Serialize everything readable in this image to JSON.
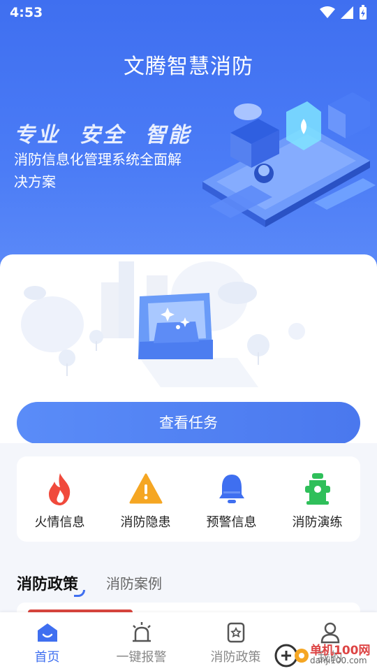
{
  "status_bar": {
    "time": "4:53"
  },
  "hero": {
    "title": "文腾智慧消防",
    "slogan": [
      "专业",
      "安全",
      "智能"
    ],
    "description": "消防信息化管理系统全面解决方案"
  },
  "task": {
    "button_label": "查看任务"
  },
  "features": [
    {
      "label": "火情信息",
      "icon": "fire-icon",
      "color": "#f04a3c"
    },
    {
      "label": "消防隐患",
      "icon": "warning-icon",
      "color": "#f5a623"
    },
    {
      "label": "预警信息",
      "icon": "bell-icon",
      "color": "#3f6ff0"
    },
    {
      "label": "消防演练",
      "icon": "hydrant-icon",
      "color": "#2fbf5a"
    }
  ],
  "content_tabs": {
    "active": "消防政策",
    "inactive": "消防案例"
  },
  "bottom_nav": [
    {
      "label": "首页",
      "icon": "home-icon",
      "active": true
    },
    {
      "label": "一键报警",
      "icon": "alarm-icon",
      "active": false
    },
    {
      "label": "消防政策",
      "icon": "policy-icon",
      "active": false
    },
    {
      "label": "我的",
      "icon": "user-icon",
      "active": false
    }
  ],
  "watermark": {
    "text": "单机100网",
    "sub": "danji100.com"
  },
  "colors": {
    "primary": "#3f6ff0",
    "background": "#f4f6fb"
  }
}
